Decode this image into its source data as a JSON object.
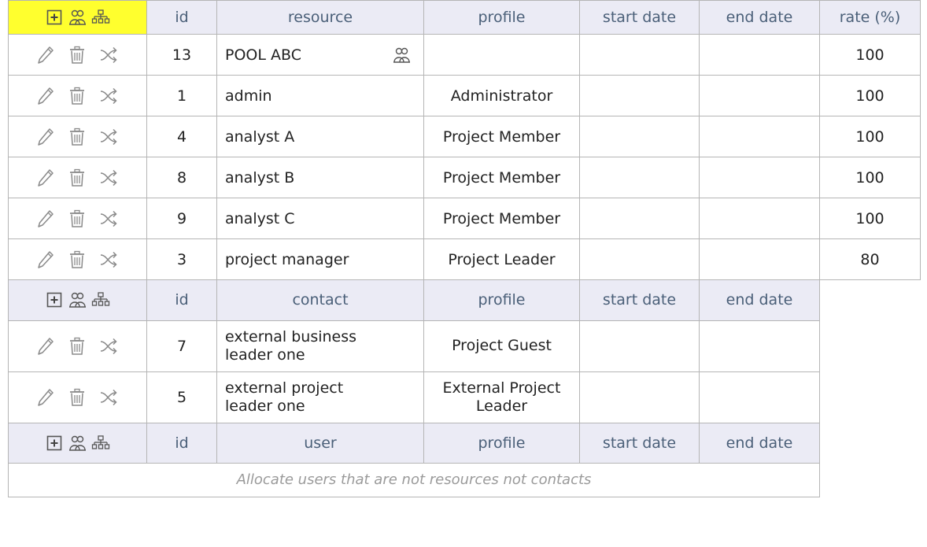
{
  "resources": {
    "header": {
      "id": "id",
      "name": "resource",
      "profile": "profile",
      "start_date": "start date",
      "end_date": "end date",
      "rate": "rate (%)"
    },
    "rows": [
      {
        "id": "13",
        "name": "POOL ABC",
        "profile": "",
        "rate": "100",
        "is_pool": true
      },
      {
        "id": "1",
        "name": "admin",
        "profile": "Administrator",
        "rate": "100"
      },
      {
        "id": "4",
        "name": "analyst A",
        "profile": "Project Member",
        "rate": "100"
      },
      {
        "id": "8",
        "name": "analyst B",
        "profile": "Project Member",
        "rate": "100"
      },
      {
        "id": "9",
        "name": "analyst C",
        "profile": "Project Member",
        "rate": "100"
      },
      {
        "id": "3",
        "name": "project manager",
        "profile": "Project Leader",
        "rate": "80"
      }
    ]
  },
  "contacts": {
    "header": {
      "id": "id",
      "name": "contact",
      "profile": "profile",
      "start_date": "start date",
      "end_date": "end date"
    },
    "rows": [
      {
        "id": "7",
        "name_line1": "external business",
        "name_line2": "leader one",
        "profile_line1": "Project Guest",
        "profile_line2": ""
      },
      {
        "id": "5",
        "name_line1": "external project",
        "name_line2": "leader one",
        "profile_line1": "External Project",
        "profile_line2": "Leader"
      }
    ]
  },
  "users": {
    "header": {
      "id": "id",
      "name": "user",
      "profile": "profile",
      "start_date": "start date",
      "end_date": "end date"
    },
    "empty_message": "Allocate users that are not resources not contacts"
  },
  "icons": {
    "add": "add-box-icon",
    "pool": "pool-users-icon",
    "structure": "org-chart-icon",
    "edit": "pencil-icon",
    "delete": "trash-icon",
    "assign": "shuffle-icon"
  },
  "colors": {
    "header_bg": "#ebebf5",
    "header_text": "#4a5f78",
    "highlight": "#ffff2e",
    "border": "#b5b5b5",
    "icon": "#8a8a8a"
  }
}
